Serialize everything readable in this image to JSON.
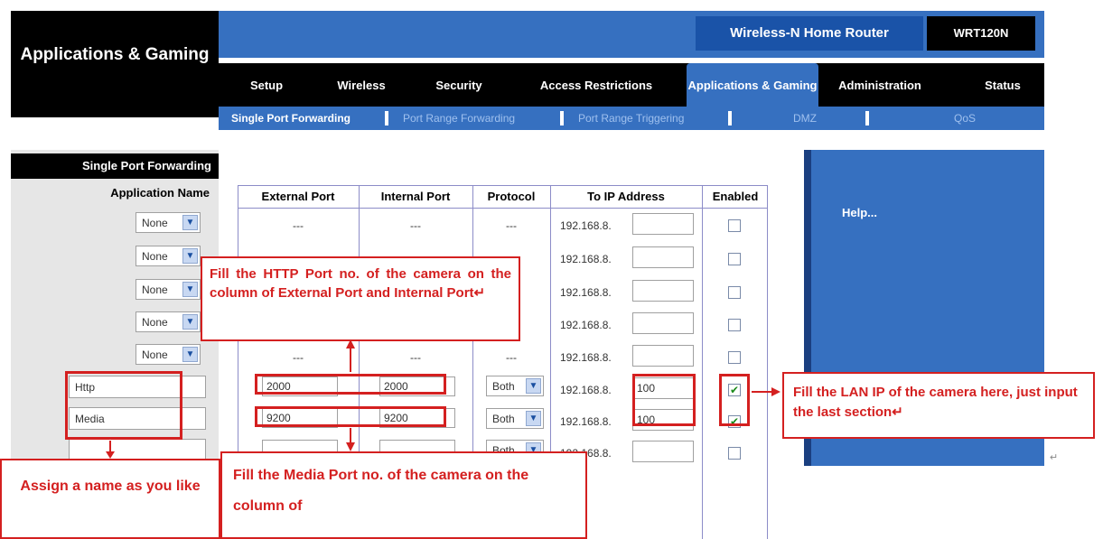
{
  "header": {
    "section_title": "Applications & Gaming",
    "router_name": "Wireless-N Home Router",
    "model": "WRT120N"
  },
  "nav": {
    "tabs": [
      "Setup",
      "Wireless",
      "Security",
      "Access Restrictions",
      "Applications & Gaming",
      "Administration",
      "Status"
    ],
    "active": "Applications & Gaming"
  },
  "subnav": {
    "tabs": [
      "Single Port Forwarding",
      "Port Range Forwarding",
      "Port Range Triggering",
      "DMZ",
      "QoS"
    ],
    "active": "Single Port Forwarding"
  },
  "sidebar": {
    "label": "Single Port Forwarding",
    "app_name_label": "Application Name"
  },
  "table": {
    "headers": [
      "External Port",
      "Internal Port",
      "Protocol",
      "To IP Address",
      "Enabled"
    ],
    "ip_prefix": "192.168.8.",
    "placeholder": "---",
    "preset_rows": [
      {
        "app": "None",
        "external": "---",
        "internal": "---",
        "protocol": "---",
        "ip_last": "",
        "enabled": false
      },
      {
        "app": "None",
        "external": "---",
        "internal": "---",
        "protocol": "---",
        "ip_last": "",
        "enabled": false
      },
      {
        "app": "None",
        "external": "---",
        "internal": "---",
        "protocol": "---",
        "ip_last": "",
        "enabled": false
      },
      {
        "app": "None",
        "external": "---",
        "internal": "---",
        "protocol": "---",
        "ip_last": "",
        "enabled": false
      },
      {
        "app": "None",
        "external": "---",
        "internal": "---",
        "protocol": "---",
        "ip_last": "",
        "enabled": false
      }
    ],
    "custom_rows": [
      {
        "name": "Http",
        "external": "2000",
        "internal": "2000",
        "protocol": "Both",
        "ip_last": "100",
        "enabled": true
      },
      {
        "name": "Media",
        "external": "9200",
        "internal": "9200",
        "protocol": "Both",
        "ip_last": "100",
        "enabled": true
      },
      {
        "name": "",
        "external": "",
        "internal": "",
        "protocol": "Both",
        "ip_last": "",
        "enabled": false
      }
    ]
  },
  "help": {
    "label": "Help..."
  },
  "annotations": {
    "http_port_note": "Fill the HTTP Port no. of the camera on the column of External Port and Internal Port↵",
    "lan_ip_note": "Fill the LAN IP of the camera here, just input the last section↵",
    "assign_name_note": "Assign a name as you like",
    "media_port_note": "Fill the Media Port no. of the camera on the column of",
    "return_mark": "↵"
  },
  "colors": {
    "accent_blue": "#3670c0",
    "annotation_red": "#d42020",
    "header_black": "#000000"
  }
}
